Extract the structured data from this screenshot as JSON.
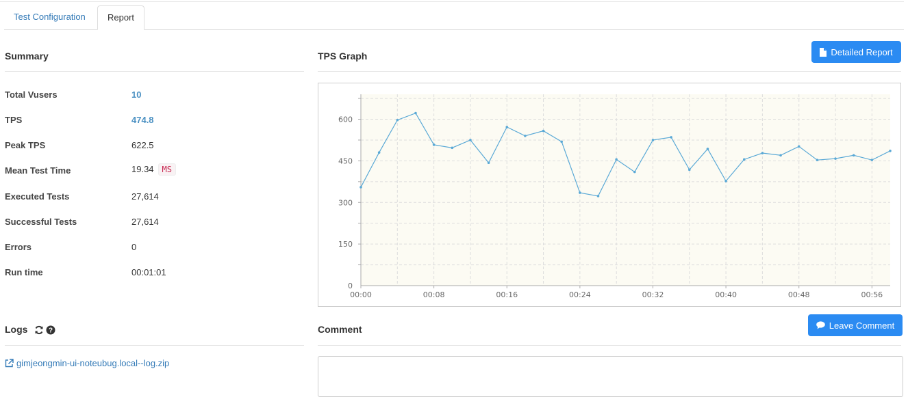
{
  "tabs": [
    {
      "label": "Test Configuration",
      "active": false
    },
    {
      "label": "Report",
      "active": true
    }
  ],
  "summary": {
    "title": "Summary",
    "rows": [
      {
        "label": "Total Vusers",
        "value": "10"
      },
      {
        "label": "TPS",
        "value": "474.8"
      },
      {
        "label": "Peak TPS",
        "value": "622.5"
      },
      {
        "label": "Mean Test Time",
        "value": "19.34",
        "unit": "MS"
      },
      {
        "label": "Executed Tests",
        "value": "27,614"
      },
      {
        "label": "Successful Tests",
        "value": "27,614"
      },
      {
        "label": "Errors",
        "value": "0"
      },
      {
        "label": "Run time",
        "value": "00:01:01"
      }
    ]
  },
  "tps_graph": {
    "title": "TPS Graph",
    "detailed_report_label": "Detailed Report"
  },
  "logs": {
    "title": "Logs",
    "file_link": "gimjeongmin-ui-noteubug.local--log.zip"
  },
  "comment": {
    "title": "Comment",
    "leave_comment_label": "Leave Comment"
  },
  "colors": {
    "accent": "#2b8bf2",
    "line": "#5aa9d6",
    "plot_bg": "#fcfbf3",
    "link": "#337ab7"
  },
  "chart_data": {
    "type": "line",
    "x": [
      "00:00",
      "00:02",
      "00:04",
      "00:06",
      "00:08",
      "00:10",
      "00:12",
      "00:14",
      "00:16",
      "00:18",
      "00:20",
      "00:22",
      "00:24",
      "00:26",
      "00:28",
      "00:30",
      "00:32",
      "00:34",
      "00:36",
      "00:38",
      "00:40",
      "00:42",
      "00:44",
      "00:46",
      "00:48",
      "00:50",
      "00:52",
      "00:54",
      "00:56",
      "00:58"
    ],
    "values": [
      355,
      480,
      597,
      622,
      508,
      497,
      525,
      443,
      572,
      540,
      558,
      519,
      335,
      323,
      455,
      410,
      525,
      535,
      418,
      493,
      377,
      455,
      478,
      470,
      502,
      453,
      458,
      470,
      453,
      486
    ],
    "x_tick_labels": [
      "00:00",
      "00:08",
      "00:16",
      "00:24",
      "00:32",
      "00:40",
      "00:48",
      "00:56"
    ],
    "y_tick_labels": [
      "0",
      "150",
      "300",
      "450",
      "600"
    ],
    "ylim": [
      0,
      690
    ],
    "xlim": [
      "00:00",
      "00:58"
    ],
    "grid": true
  }
}
